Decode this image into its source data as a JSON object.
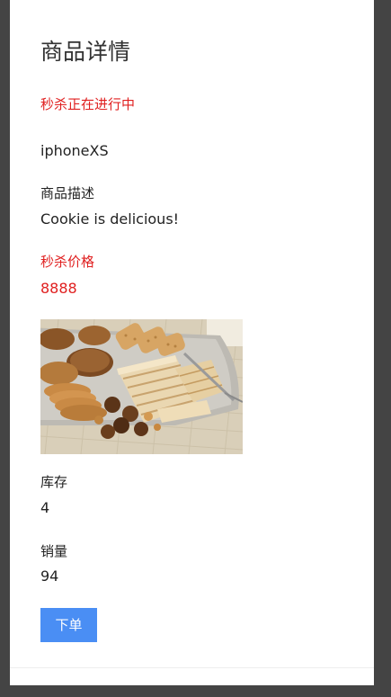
{
  "page": {
    "title": "商品详情",
    "status": "秒杀正在进行中"
  },
  "product": {
    "name": "iphoneXS",
    "description_label": "商品描述",
    "description": "Cookie is delicious!",
    "price_label": "秒杀价格",
    "price": "8888",
    "stock_label": "库存",
    "stock": "4",
    "sales_label": "销量",
    "sales": "94"
  },
  "actions": {
    "buy_label": "下单"
  },
  "colors": {
    "accent_red": "#e02020",
    "button_blue": "#4a8ef4",
    "outer_background": "#444444"
  }
}
